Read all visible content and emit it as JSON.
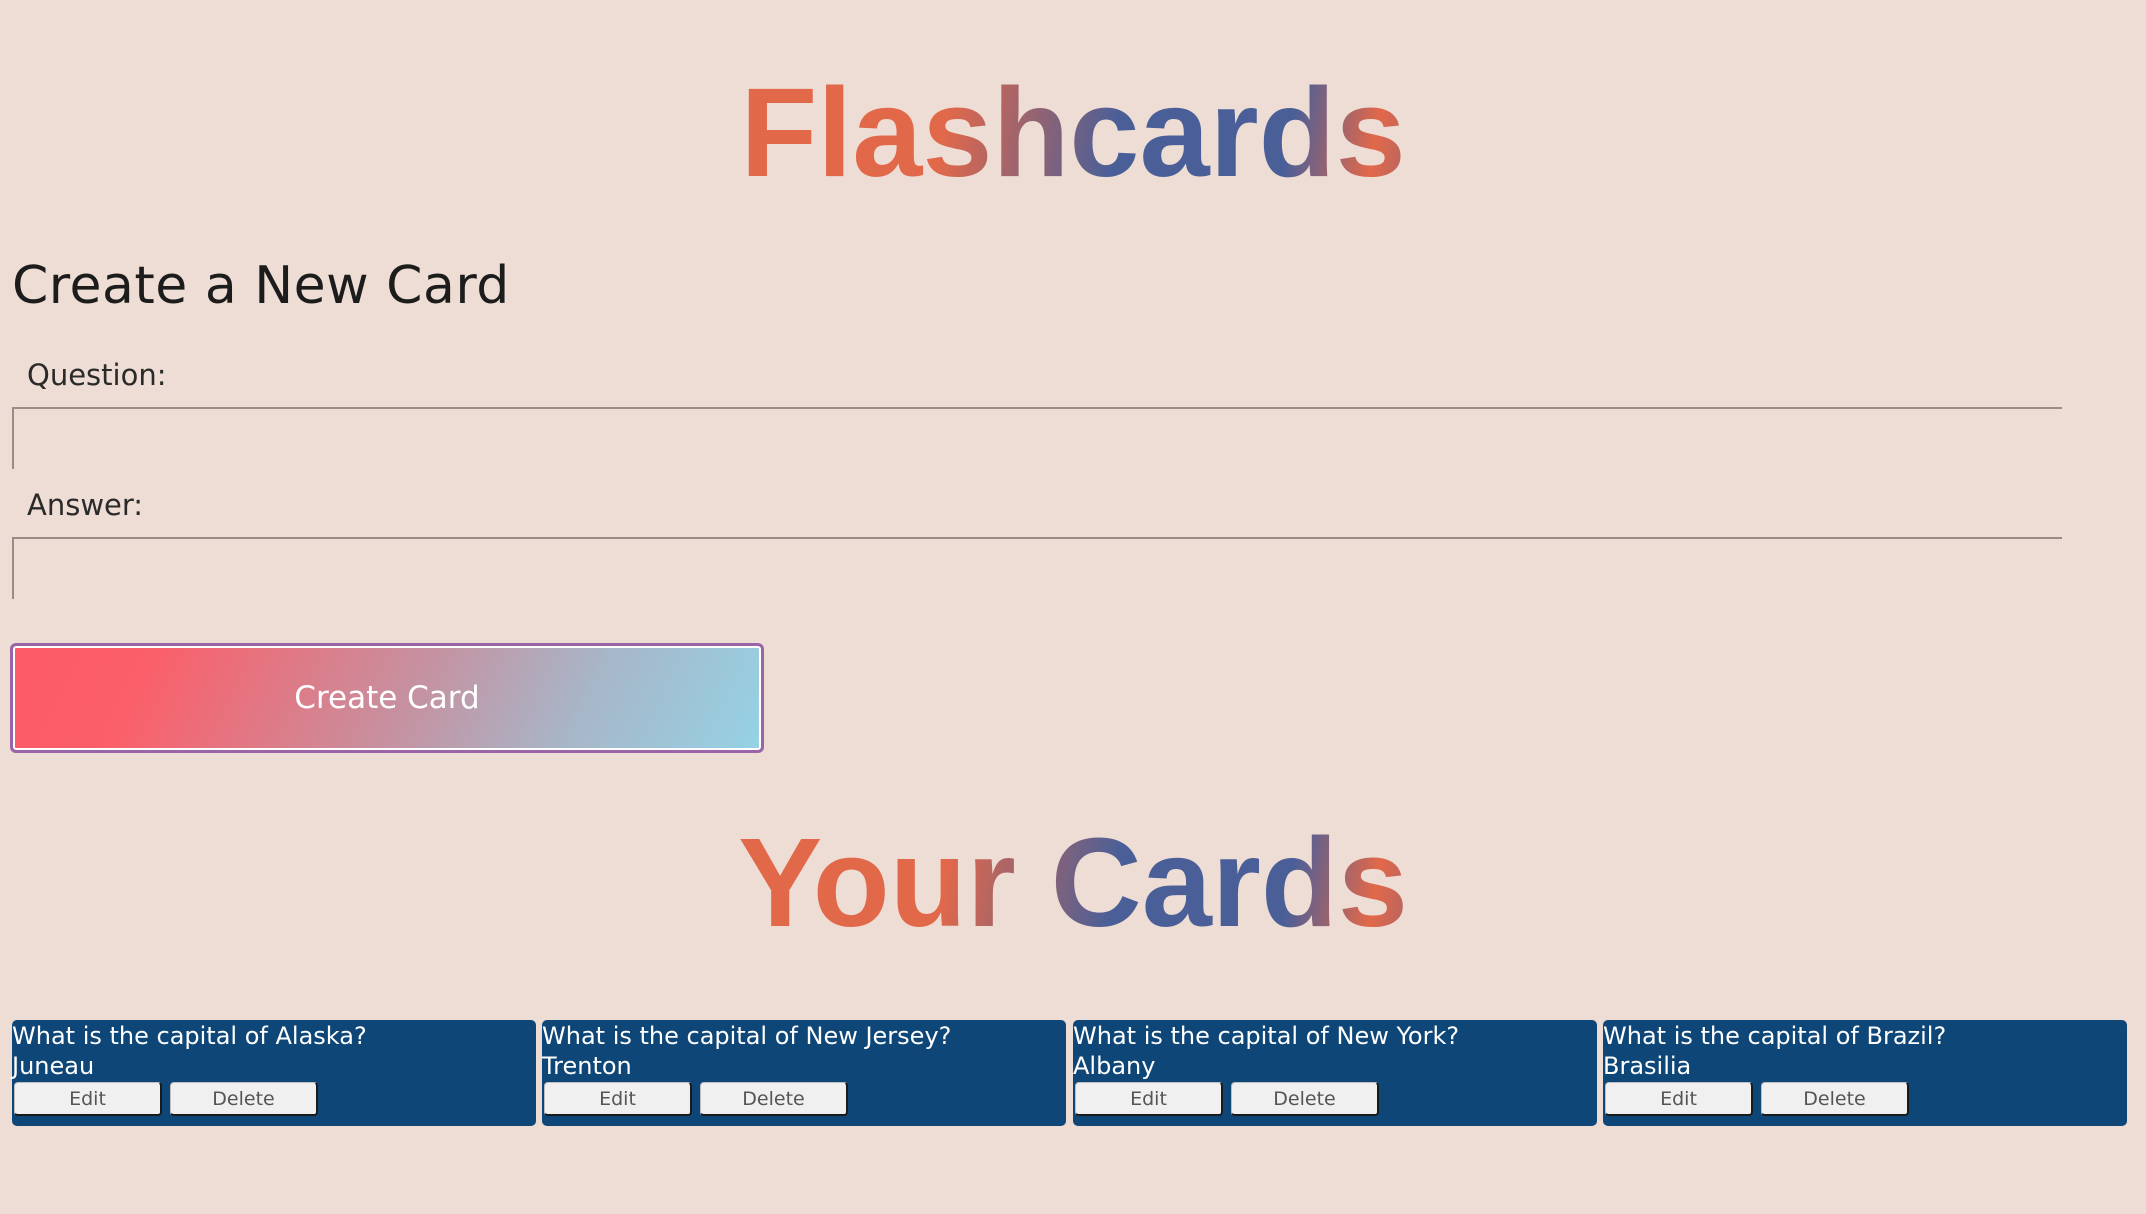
{
  "app": {
    "title": "Flashcards"
  },
  "form": {
    "heading": "Create a New Card",
    "question_label": "Question:",
    "question_value": "",
    "answer_label": "Answer:",
    "answer_value": "",
    "submit_label": "Create Card"
  },
  "cards_section": {
    "title": "Your Cards"
  },
  "cards": [
    {
      "question": "What is the capital of Alaska?",
      "answer": "Juneau",
      "edit_label": "Edit",
      "delete_label": "Delete"
    },
    {
      "question": "What is the capital of New Jersey?",
      "answer": "Trenton",
      "edit_label": "Edit",
      "delete_label": "Delete"
    },
    {
      "question": "What is the capital of New York?",
      "answer": "Albany",
      "edit_label": "Edit",
      "delete_label": "Delete"
    },
    {
      "question": "What is the capital of Brazil?",
      "answer": "Brasilia",
      "edit_label": "Edit",
      "delete_label": "Delete"
    }
  ],
  "colors": {
    "background": "#eeddd4",
    "card_background": "#0e4678",
    "title_blue": "#4a5f98",
    "title_orange": "#e2684a",
    "title_green": "#8a9a62",
    "button_gradient_start": "#fc5a66",
    "button_gradient_end": "#95d2e5"
  }
}
